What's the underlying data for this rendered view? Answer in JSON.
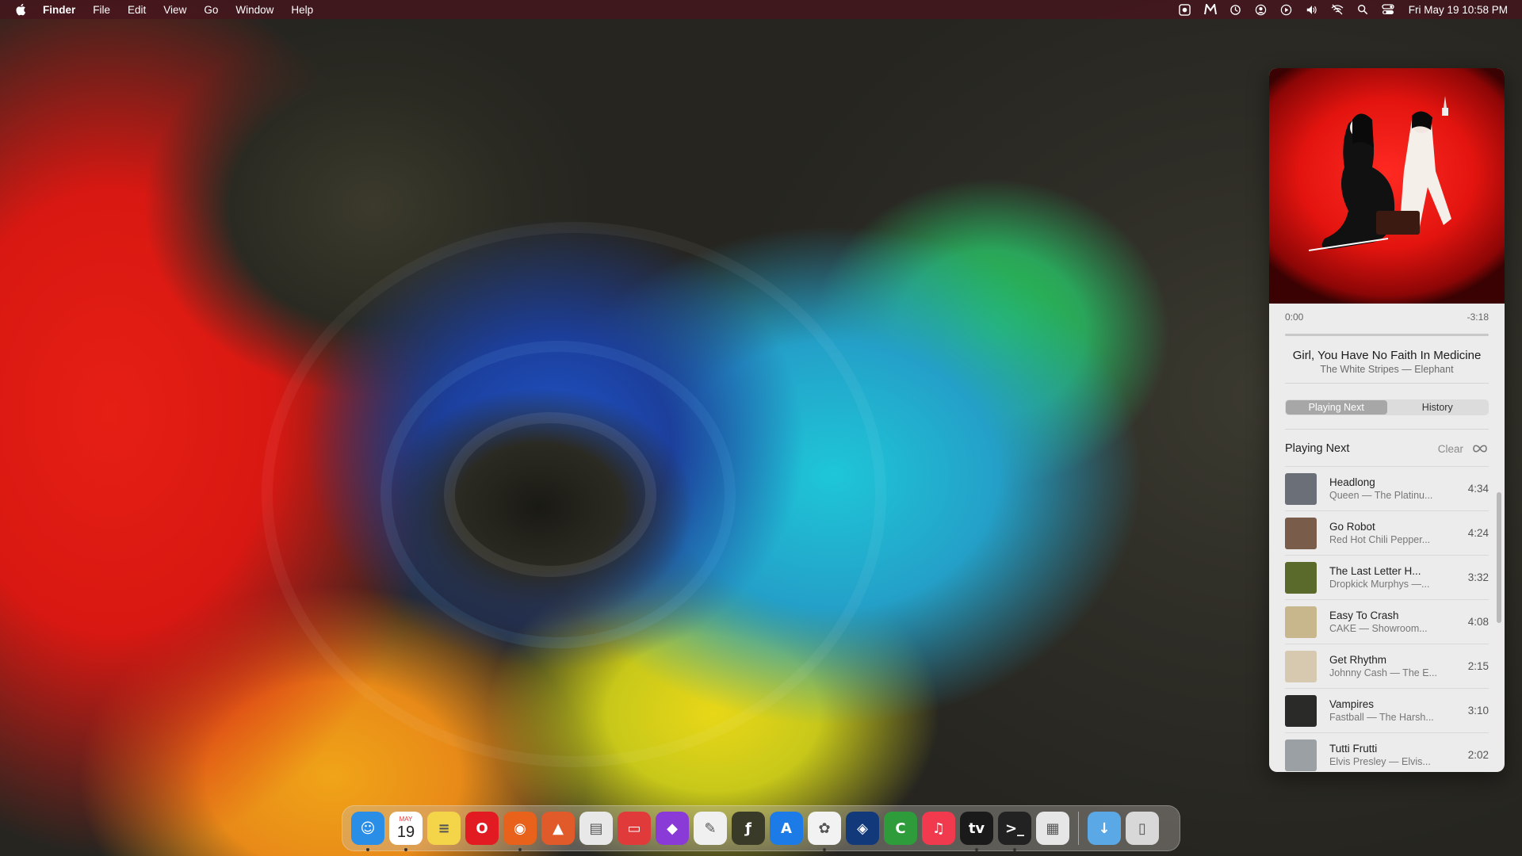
{
  "menubar": {
    "app_name": "Finder",
    "menus": [
      "File",
      "Edit",
      "View",
      "Go",
      "Window",
      "Help"
    ],
    "clock": "Fri May 19  10:58 PM"
  },
  "player": {
    "time_elapsed": "0:00",
    "time_remaining": "-3:18",
    "progress": 0,
    "track_title": "Girl, You Have No Faith In Medicine",
    "track_subtitle": "The White Stripes — Elephant",
    "tabs": {
      "playing_next": "Playing Next",
      "history": "History"
    },
    "queue_title": "Playing Next",
    "clear_label": "Clear",
    "queue": [
      {
        "name": "Headlong",
        "artist": "Queen — The Platinu...",
        "duration": "4:34",
        "color": "#6b6f78"
      },
      {
        "name": "Go Robot",
        "artist": "Red Hot Chili Pepper...",
        "duration": "4:24",
        "color": "#7a5c4a"
      },
      {
        "name": "The Last Letter H...",
        "artist": "Dropkick Murphys —...",
        "duration": "3:32",
        "color": "#5a6a2a"
      },
      {
        "name": "Easy To Crash",
        "artist": "CAKE — Showroom...",
        "duration": "4:08",
        "color": "#c8b68c"
      },
      {
        "name": "Get Rhythm",
        "artist": "Johnny Cash — The E...",
        "duration": "2:15",
        "color": "#d6c9b0"
      },
      {
        "name": "Vampires",
        "artist": "Fastball — The Harsh...",
        "duration": "3:10",
        "color": "#2a2a28"
      },
      {
        "name": "Tutti Frutti",
        "artist": "Elvis Presley — Elvis...",
        "duration": "2:02",
        "color": "#9aa0a4"
      }
    ]
  },
  "dock": {
    "calendar_month": "MAY",
    "calendar_day": "19",
    "items": [
      {
        "name": "finder",
        "color": "#2a8ee6",
        "glyph": "☺"
      },
      {
        "name": "calendar",
        "color": "#ffffff",
        "glyph": ""
      },
      {
        "name": "notes",
        "color": "#f4d54a",
        "glyph": "≡"
      },
      {
        "name": "opera",
        "color": "#e21b23",
        "glyph": "O"
      },
      {
        "name": "firefox",
        "color": "#e8621c",
        "glyph": "◉"
      },
      {
        "name": "affinity",
        "color": "#e05a2a",
        "glyph": "▲"
      },
      {
        "name": "preview",
        "color": "#e8e8e8",
        "glyph": "▤"
      },
      {
        "name": "printer",
        "color": "#e03a3a",
        "glyph": "▭"
      },
      {
        "name": "affinity-photo",
        "color": "#8a3ad6",
        "glyph": "◆"
      },
      {
        "name": "pixelmator",
        "color": "#f0f0f0",
        "glyph": "✎"
      },
      {
        "name": "font-app",
        "color": "#3a3a28",
        "glyph": "ƒ"
      },
      {
        "name": "app-store",
        "color": "#1c7be6",
        "glyph": "A"
      },
      {
        "name": "photos",
        "color": "#f2f2f2",
        "glyph": "✿"
      },
      {
        "name": "cube-app",
        "color": "#123a7a",
        "glyph": "◈"
      },
      {
        "name": "facetime",
        "color": "#2e9c3a",
        "glyph": "C"
      },
      {
        "name": "music",
        "color": "#f23a4e",
        "glyph": "♫"
      },
      {
        "name": "tv",
        "color": "#1a1a1a",
        "glyph": "tv"
      },
      {
        "name": "terminal",
        "color": "#222222",
        "glyph": ">_"
      },
      {
        "name": "launchpad",
        "color": "#e6e6e6",
        "glyph": "▦"
      },
      {
        "name": "downloads",
        "color": "#5aa8e6",
        "glyph": "↓"
      },
      {
        "name": "trash",
        "color": "#d8d8d8",
        "glyph": "▯"
      }
    ]
  }
}
